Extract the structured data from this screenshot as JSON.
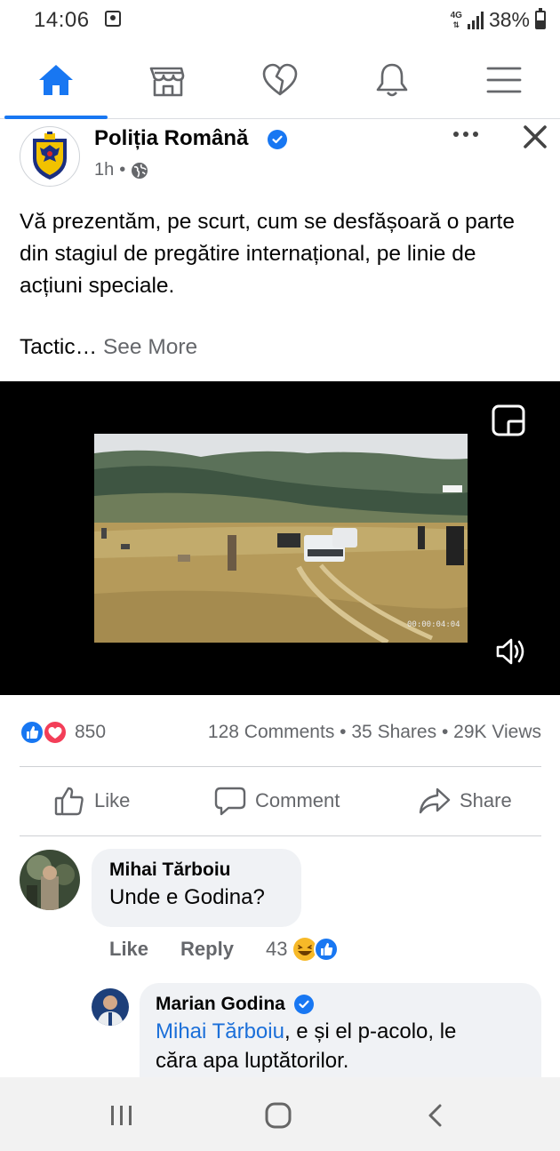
{
  "status_bar": {
    "time": "14:06",
    "network": "4G",
    "battery": "38%"
  },
  "nav": {
    "items": [
      {
        "name": "home-icon",
        "active": true
      },
      {
        "name": "marketplace-icon",
        "active": false
      },
      {
        "name": "dating-heart-icon",
        "active": false
      },
      {
        "name": "notifications-bell-icon",
        "active": false
      },
      {
        "name": "menu-icon",
        "active": false
      }
    ],
    "accent": "#1877f2"
  },
  "post": {
    "page_name": "Poliția Română",
    "verified": true,
    "time": "1h",
    "separator": "•",
    "text": "Vă prezentăm, pe scurt, cum se desfășoară o parte din stagiul de pregătire internațional, pe linie de acțiuni speciale.",
    "text_continued": "Tactic…",
    "see_more": "See More",
    "video": {
      "timestamp": "00:00:04:04"
    },
    "stats": {
      "reactions": "850",
      "comments": "128 Comments",
      "shares": "35 Shares",
      "views": "29K Views",
      "dot": "•"
    },
    "actions": {
      "like": "Like",
      "comment": "Comment",
      "share": "Share"
    }
  },
  "comments": [
    {
      "author": "Mihai Tărboiu",
      "text": "Unde e Godina?",
      "like_label": "Like",
      "reply_label": "Reply",
      "reactions": "43"
    },
    {
      "author": "Marian Godina",
      "verified": true,
      "mention": "Mihai Tărboiu",
      "text_after_mention": ", e și el p-acolo, le",
      "text_line2": "căra apa luptătorilor."
    }
  ]
}
